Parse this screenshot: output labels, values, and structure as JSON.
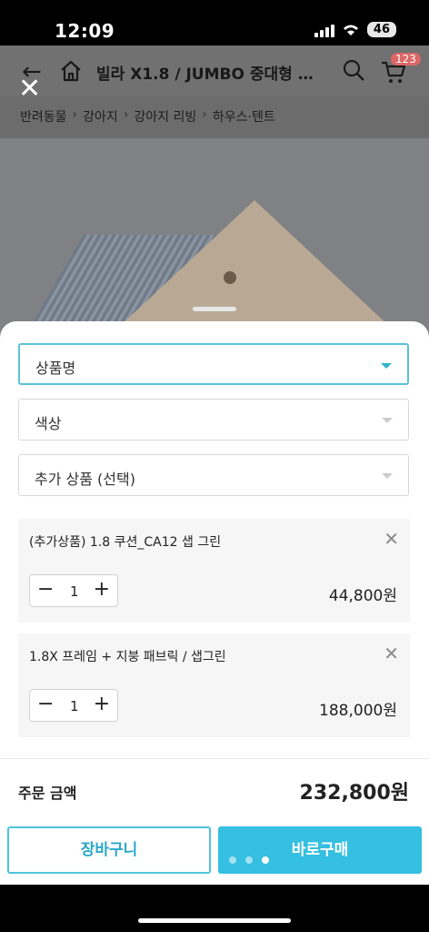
{
  "status": {
    "time": "12:09",
    "battery": "46"
  },
  "header": {
    "title": "빌라 X1.8 / JUMBO 중대형 원...",
    "cart_badge": "123",
    "breadcrumb": [
      "반려동물",
      "강아지",
      "강아지 리빙",
      "하우스·텐트"
    ]
  },
  "options": {
    "product_name": "상품명",
    "color": "색상",
    "extra": "추가 상품 (선택)"
  },
  "items": [
    {
      "name": "(추가상품) 1.8 쿠션_CA12 샙 그린",
      "qty": "1",
      "price": "44,800원"
    },
    {
      "name": "1.8X 프레임 + 지붕 패브릭 / 샙그린",
      "qty": "1",
      "price": "188,000원"
    }
  ],
  "total": {
    "label": "주문 금액",
    "value": "232,800원"
  },
  "actions": {
    "cart": "장바구니",
    "buy": "바로구매"
  },
  "colors": {
    "accent": "#35bfe0",
    "select_border": "#5bc2d6"
  },
  "icons": [
    "back-arrow-icon",
    "close-icon",
    "home-icon",
    "search-icon",
    "cart-icon",
    "chevron-down-icon",
    "minus-icon",
    "plus-icon"
  ]
}
